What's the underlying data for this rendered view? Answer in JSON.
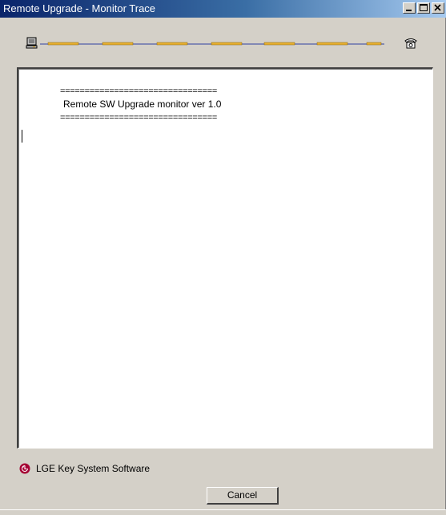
{
  "window": {
    "title": "Remote Upgrade - Monitor Trace",
    "controls": [
      "minimize-icon",
      "maximize-icon",
      "close-icon"
    ]
  },
  "progress": {
    "left_icon": "computer-icon",
    "right_icon": "telephone-icon",
    "dash_color": "#e8b030",
    "line_color": "#3040a0"
  },
  "trace": {
    "separator_top": "================================",
    "banner": "Remote SW Upgrade monitor ver 1.0",
    "separator_bottom": "================================"
  },
  "footer": {
    "brand_icon": "lg-logo-icon",
    "brand_text": "LGE Key System Software",
    "cancel_label": "Cancel"
  },
  "colors": {
    "titlebar_start": "#0a246a",
    "titlebar_end": "#a6caf0",
    "face": "#d4d0c8",
    "brand": "#a50034"
  }
}
